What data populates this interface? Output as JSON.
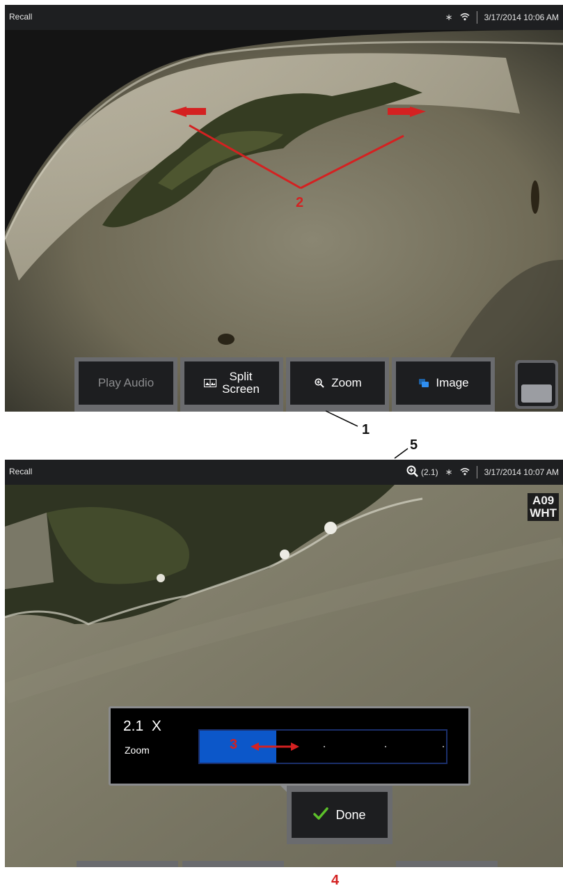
{
  "colors": {
    "status_bar": "#1e1f21",
    "softkey_frame": "#6a6b6e",
    "softkey_face": "#1d1e20",
    "zoom_fill": "#0c57c9",
    "annotation_red": "#d42121",
    "done_check": "#5cc12a"
  },
  "screen1": {
    "statusbar": {
      "title": "Recall",
      "icons": [
        "bluetooth-icon",
        "wifi-icon"
      ],
      "datetime": "3/17/2014 10:06 AM"
    },
    "softkeys": [
      {
        "label": "Play Audio",
        "icon": "",
        "enabled": false
      },
      {
        "label": "Split Screen",
        "label_lines": [
          "Split",
          "Screen"
        ],
        "icon": "split-screen-icon",
        "enabled": true
      },
      {
        "label": "Zoom",
        "icon": "zoom-icon",
        "enabled": true
      },
      {
        "label": "Image",
        "icon": "image-icon",
        "enabled": true
      }
    ],
    "side_button_icon": "toggle-icon"
  },
  "screen2": {
    "statusbar": {
      "title": "Recall",
      "zoom_indicator": "(2.1)",
      "icons": [
        "zoom-icon",
        "bluetooth-icon",
        "wifi-icon"
      ],
      "datetime": "3/17/2014 10:07 AM"
    },
    "badge": {
      "line1": "A09",
      "line2": "WHT"
    },
    "zoom_control": {
      "value": "2.1",
      "unit": "X",
      "label": "Zoom",
      "fill_fraction": 0.31
    },
    "done_button": {
      "label": "Done",
      "icon": "checkmark-icon"
    }
  },
  "annotations": {
    "callout_1": "1",
    "callout_2": "2",
    "callout_3": "3",
    "callout_4": "4",
    "callout_5": "5"
  }
}
